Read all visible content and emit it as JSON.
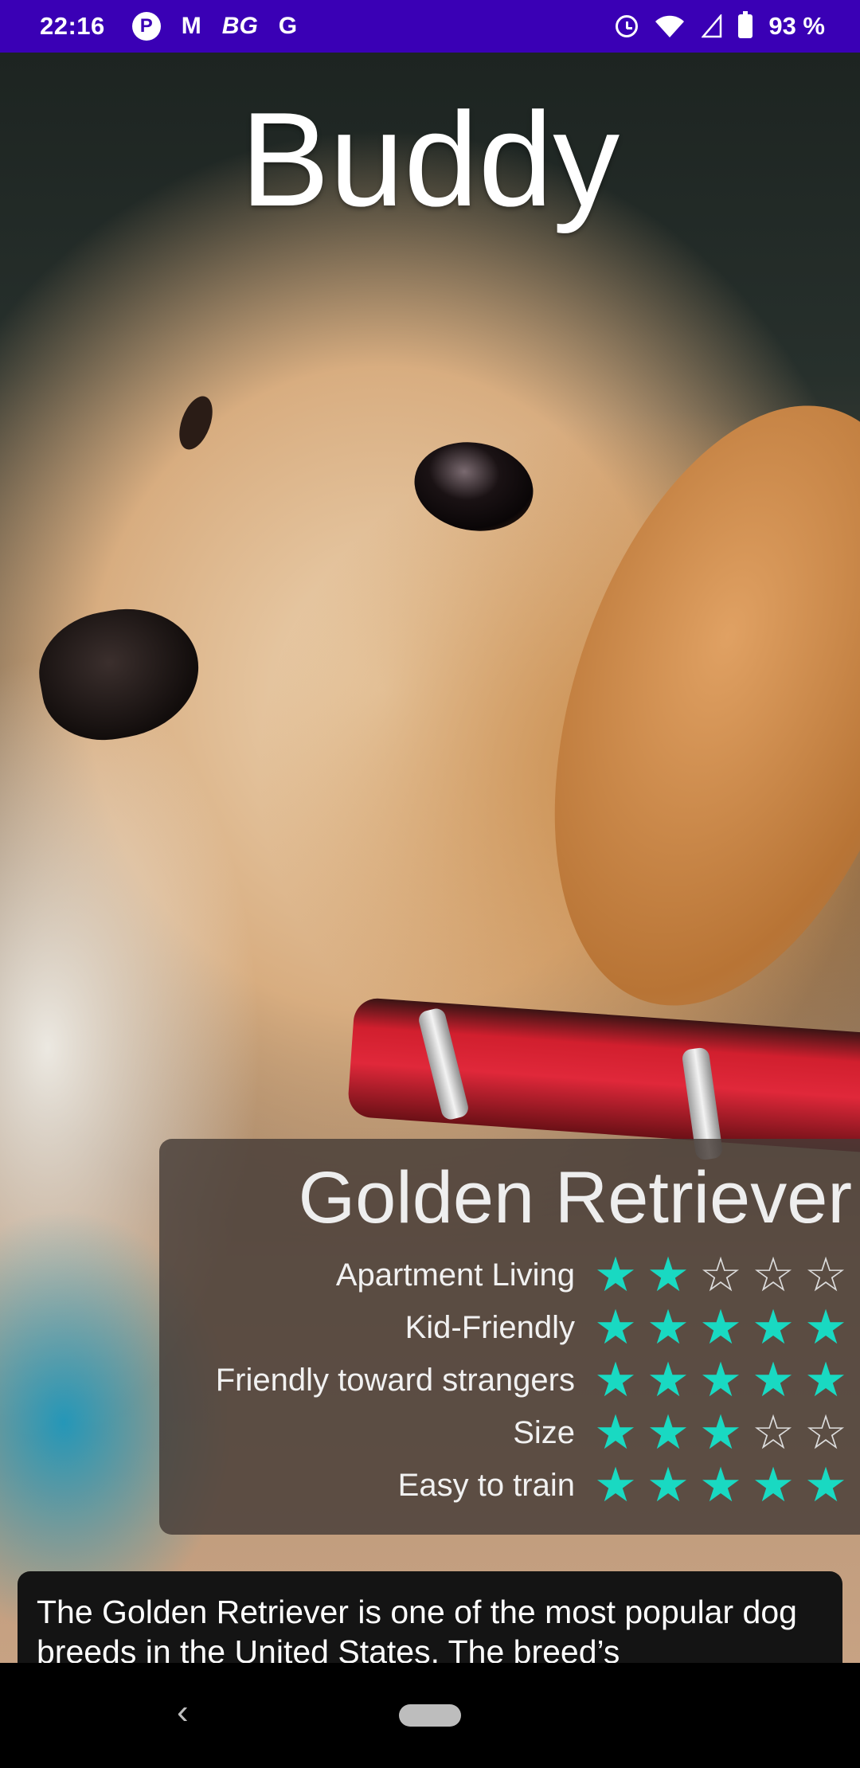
{
  "status_bar": {
    "time": "22:16",
    "app_icons": [
      "P",
      "M",
      "BG",
      "G"
    ],
    "icons": [
      "alarm-icon",
      "wifi-icon",
      "signal-icon",
      "battery-icon"
    ],
    "battery_level": "93 %",
    "background_color": "#3a00b5"
  },
  "dog": {
    "name": "Buddy",
    "breed": "Golden Retriever"
  },
  "traits": [
    {
      "label": "Apartment Living",
      "rating": 2,
      "max": 5
    },
    {
      "label": "Kid-Friendly",
      "rating": 5,
      "max": 5
    },
    {
      "label": "Friendly toward strangers",
      "rating": 5,
      "max": 5
    },
    {
      "label": "Size",
      "rating": 3,
      "max": 5
    },
    {
      "label": "Easy to train",
      "rating": 5,
      "max": 5
    }
  ],
  "description": "The Golden Retriever is one of the most popular dog breeds in the United States. The breed’s",
  "colors": {
    "star_full": "#19d9c2",
    "star_empty": "#dcdcdc",
    "card_background": "#463c37"
  },
  "nav_bar": {
    "back_icon": "back-chevron-icon",
    "home_icon": "home-pill-icon"
  }
}
